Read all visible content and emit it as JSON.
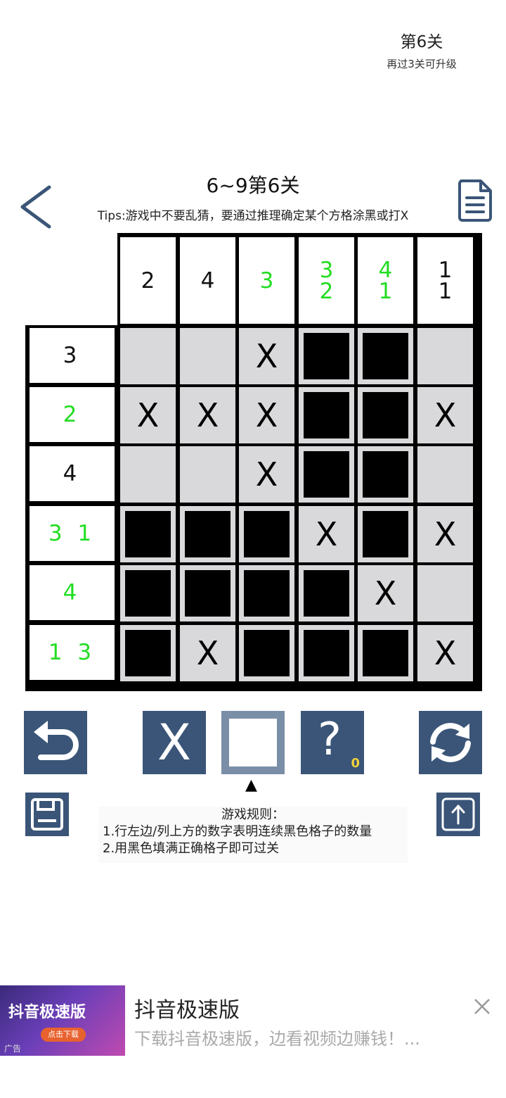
{
  "level": {
    "title": "第6关",
    "subtitle": "再过3关可升级"
  },
  "header": {
    "puzzle_title": "6~9第6关",
    "tips": "Tips:游戏中不要乱猜，要通过推理确定某个方格涂黑或打X"
  },
  "board": {
    "size": 6,
    "columns": [
      {
        "clue": [
          "2"
        ],
        "solved": false
      },
      {
        "clue": [
          "4"
        ],
        "solved": false
      },
      {
        "clue": [
          "3"
        ],
        "solved": true
      },
      {
        "clue": [
          "3",
          "2"
        ],
        "solved": true
      },
      {
        "clue": [
          "4",
          "1"
        ],
        "solved": true
      },
      {
        "clue": [
          "1",
          "1"
        ],
        "solved": false
      }
    ],
    "rows": [
      {
        "clue": "3",
        "solved": false
      },
      {
        "clue": "2",
        "solved": true
      },
      {
        "clue": "4",
        "solved": false
      },
      {
        "clue": "3 1",
        "solved": true
      },
      {
        "clue": "4",
        "solved": true
      },
      {
        "clue": "1 3",
        "solved": true
      }
    ],
    "cell_states": [
      [
        "empty",
        "empty",
        "cross",
        "filled",
        "filled",
        "empty"
      ],
      [
        "cross",
        "cross",
        "cross",
        "filled",
        "filled",
        "cross"
      ],
      [
        "empty",
        "empty",
        "cross",
        "filled",
        "filled",
        "empty"
      ],
      [
        "filled",
        "filled",
        "filled",
        "cross",
        "filled",
        "cross"
      ],
      [
        "filled",
        "filled",
        "filled",
        "filled",
        "cross",
        "empty"
      ],
      [
        "filled",
        "cross",
        "filled",
        "filled",
        "filled",
        "cross"
      ]
    ],
    "cross_symbol": "X"
  },
  "tools": {
    "cross_label": "X",
    "hint_label": "?",
    "hint_count": "0",
    "selected_marker": "▲",
    "selected_tool": "fill"
  },
  "rules": {
    "title": "游戏规则：",
    "line1": "1.行左边/列上方的数字表明连续黑色格子的数量",
    "line2": "2.用黑色填满正确格子即可过关"
  },
  "ad": {
    "thumb_label": "抖音极速版",
    "thumb_cta": "点击下载",
    "thumb_footer": "广告",
    "title": "抖音极速版",
    "description": "下载抖音极速版，边看视频边赚钱！..."
  },
  "colors": {
    "solved_clue": "#22dd22",
    "tool_button": "#3a5577",
    "cell_bg": "#d9d9db"
  },
  "icons": [
    "back-arrow-icon",
    "document-icon",
    "undo-icon",
    "refresh-icon",
    "save-icon",
    "share-icon",
    "close-icon"
  ]
}
